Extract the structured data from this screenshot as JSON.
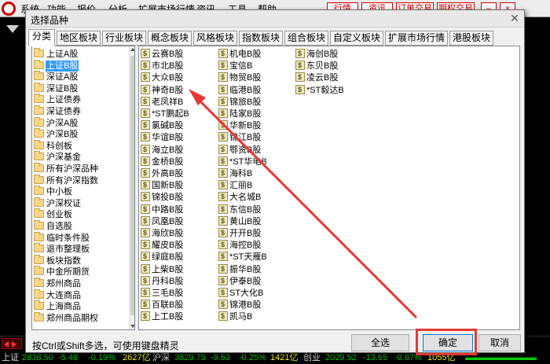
{
  "app": {
    "menus": [
      "系统",
      "功能",
      "报价",
      "分析",
      "扩展市场行情",
      "资讯",
      "工具",
      "帮助"
    ],
    "buttons": [
      "行情",
      "资讯",
      "订单交易",
      "期权交易"
    ],
    "right_icons": [
      "minimize-icon",
      "close-icon"
    ]
  },
  "dialog": {
    "title": "选择品种",
    "tabs": [
      "分类",
      "地区板块",
      "行业板块",
      "概念板块",
      "风格板块",
      "指数板块",
      "组合板块",
      "自定义板块",
      "扩展市场行情",
      "港股板块"
    ],
    "active_tab": "分类",
    "tree": [
      {
        "label": "上证A股",
        "selected": false
      },
      {
        "label": "上证B股",
        "selected": true
      },
      {
        "label": "深证A股",
        "selected": false
      },
      {
        "label": "深证B股",
        "selected": false
      },
      {
        "label": "上证债券",
        "selected": false
      },
      {
        "label": "深证债券",
        "selected": false
      },
      {
        "label": "沪深A股",
        "selected": false
      },
      {
        "label": "沪深B股",
        "selected": false
      },
      {
        "label": "科创板",
        "selected": false
      },
      {
        "label": "沪深基金",
        "selected": false
      },
      {
        "label": "所有沪深品种",
        "selected": false
      },
      {
        "label": "所有沪深指数",
        "selected": false
      },
      {
        "label": "中小板",
        "selected": false
      },
      {
        "label": "沪深权证",
        "selected": false
      },
      {
        "label": "创业板",
        "selected": false
      },
      {
        "label": "自选股",
        "selected": false
      },
      {
        "label": "临时条件股",
        "selected": false
      },
      {
        "label": "退市整理板",
        "selected": false
      },
      {
        "label": "板块指数",
        "selected": false
      },
      {
        "label": "中金所期货",
        "selected": false
      },
      {
        "label": "郑州商品",
        "selected": false
      },
      {
        "label": "大连商品",
        "selected": false
      },
      {
        "label": "上海商品",
        "selected": false
      },
      {
        "label": "郑州商品期权",
        "selected": false
      }
    ],
    "stock_columns": [
      [
        "云赛B股",
        "市北B股",
        "大众B股",
        "神奇B股",
        "老凤祥B",
        "*ST鹏起B",
        "氯碱B股",
        "华谊B股",
        "海立B股",
        "金桥B股",
        "外高B股",
        "国新B股",
        "锦投B股",
        "中路B股",
        "凤凰B股",
        "海欣B股",
        "耀皮B股",
        "绿庭B股",
        "上柴B股",
        "丹科B股",
        "三毛B股",
        "百联B股",
        "上工B股"
      ],
      [
        "机电B股",
        "宝信B",
        "物贸B股",
        "临港B股",
        "锦旅B股",
        "陆家B股",
        "华新B股",
        "锦江B股",
        "鄂资B股",
        "*ST华电B",
        "海科B",
        "汇丽B",
        "大名城B",
        "东信B股",
        "黄山B股",
        "开开B股",
        "海控B股",
        "*ST天雁B",
        "振华B股",
        "伊泰B股",
        "ST大化B",
        "锦港B股",
        "凯马B"
      ],
      [
        "海创B股",
        "东贝B股",
        "凌云B股",
        "*ST毅达B"
      ]
    ],
    "status_text": "按Ctrl或Shift多选，可使用键盘精灵",
    "btn_select_all": "全选",
    "btn_ok": "确定",
    "btn_cancel": "取消"
  },
  "ticker": {
    "items": [
      "上证",
      "2838.50",
      "-5.48",
      "-0.19%",
      "2627亿",
      "沪深",
      "3829.75",
      "-9.63",
      "-0.25%",
      "1421亿",
      "创业",
      "2029.52",
      "-13.65",
      "-0.67%",
      "1055亿"
    ]
  },
  "colors": {
    "selection": "#3399ff",
    "highlight": "#e53935",
    "ticker_up": "#ff0000",
    "ticker_down": "#00cc00"
  }
}
